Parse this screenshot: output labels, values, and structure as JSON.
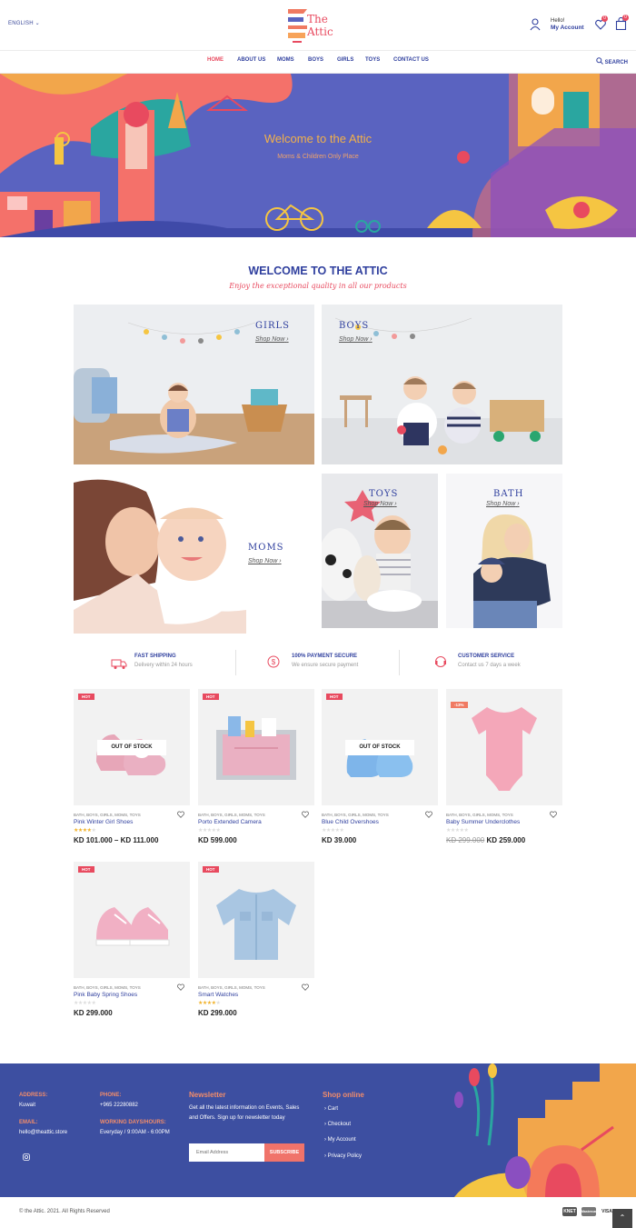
{
  "header": {
    "language": "ENGLISH",
    "logo_text": "The Attic",
    "account_hello": "Hello!",
    "account_label": "My Account",
    "wishlist_count": "0",
    "cart_count": "0",
    "search_label": "SEARCH"
  },
  "nav": {
    "items": [
      {
        "label": "HOME",
        "active": true
      },
      {
        "label": "ABOUT US"
      },
      {
        "label": "MOMS"
      },
      {
        "label": "BOYS"
      },
      {
        "label": "GIRLS"
      },
      {
        "label": "TOYS"
      },
      {
        "label": "CONTACT US"
      }
    ]
  },
  "hero": {
    "title": "Welcome to the Attic",
    "subtitle": "Moms & Children Only Place"
  },
  "welcome": {
    "title": "WELCOME TO THE ATTIC",
    "subtitle": "Enjoy the exceptional quality in all our products"
  },
  "categories": [
    {
      "label": "GIRLS",
      "shop": "Shop Now"
    },
    {
      "label": "BOYS",
      "shop": "Shop Now"
    },
    {
      "label": "MOMS",
      "shop": "Shop Now"
    },
    {
      "label": "TOYS",
      "shop": "Shop Now"
    },
    {
      "label": "BATH",
      "shop": "Shop Now"
    }
  ],
  "features": [
    {
      "title": "FAST SHIPPING",
      "desc": "Delivery within 24 hours",
      "icon": "truck-icon"
    },
    {
      "title": "100% PAYMENT SECURE",
      "desc": "We ensure secure payment",
      "icon": "dollar-icon"
    },
    {
      "title": "CUSTOMER SERVICE",
      "desc": "Contact us 7 days a week",
      "icon": "headset-icon"
    }
  ],
  "products": [
    {
      "badge": "HOT",
      "status": "OUT OF STOCK",
      "cats": "BATH, BOYS, GIRLS, MOMS, TOYS",
      "name": "Pink Winter Girl Shoes",
      "rating": 4,
      "price": "KD 101.000 – KD 111.000"
    },
    {
      "badge": "HOT",
      "cats": "BATH, BOYS, GIRLS, MOMS, TOYS",
      "name": "Porto Extended Camera",
      "rating": 0,
      "price": "KD 599.000"
    },
    {
      "badge": "HOT",
      "status": "OUT OF STOCK",
      "cats": "BATH, BOYS, GIRLS, MOMS, TOYS",
      "name": "Blue Child Overshoes",
      "rating": 0,
      "price": "KD 39.000"
    },
    {
      "sale": "-13%",
      "cats": "BATH, BOYS, GIRLS, MOMS, TOYS",
      "name": "Baby Summer Underclothes",
      "rating": 0,
      "old_price": "KD 299.000",
      "price": "KD 259.000"
    },
    {
      "badge": "HOT",
      "cats": "BATH, BOYS, GIRLS, MOMS, TOYS",
      "name": "Pink Baby Spring Shoes",
      "rating": 0,
      "price": "KD 299.000"
    },
    {
      "badge": "HOT",
      "cats": "BATH, BOYS, GIRLS, MOMS, TOYS",
      "name": "Smart Watches",
      "rating": 4,
      "price": "KD 299.000"
    }
  ],
  "footer": {
    "address_label": "ADDRESS:",
    "address": "Kuwait",
    "email_label": "EMAIL:",
    "email": "hello@theattic.store",
    "phone_label": "PHONE:",
    "phone": "+965 22280882",
    "hours_label": "WORKING DAYS/HOURS:",
    "hours": "Everyday / 9:00AM - 6:00PM",
    "newsletter_title": "Newsletter",
    "newsletter_text": "Get all the latest information on Events, Sales and Offers. Sign up for newsletter today",
    "email_placeholder": "Email Address",
    "subscribe": "SUBSCRIBE",
    "shop_title": "Shop online",
    "shop_links": [
      "Cart",
      "Checkout",
      "My Account",
      "Privacy Policy"
    ]
  },
  "copyright": "© the Attic. 2021. All Rights Reserved",
  "payments": [
    "KNET",
    "Mastercard",
    "VISA"
  ],
  "colors": {
    "brand_blue": "#2f3f9e",
    "accent_red": "#e84a5f",
    "hero_bg": "#5a63c0",
    "footer_bg": "#3d4fa1"
  }
}
